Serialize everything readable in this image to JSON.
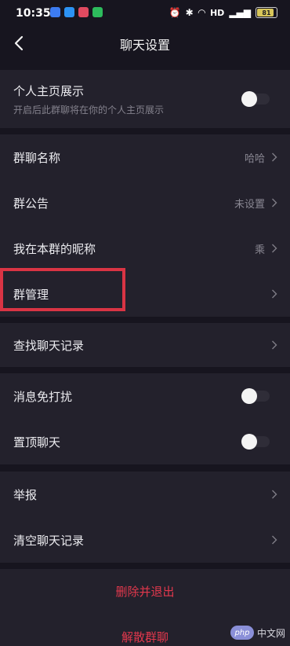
{
  "status": {
    "time": "10:35",
    "battery": "81",
    "net": "HD"
  },
  "nav": {
    "title": "聊天设置"
  },
  "profile_section": {
    "label": "个人主页展示",
    "subtitle": "开启后此群聊将在你的个人主页展示",
    "toggle_on": false
  },
  "group_section": {
    "items": [
      {
        "label": "群聊名称",
        "value": "哈哈"
      },
      {
        "label": "群公告",
        "value": "未设置"
      },
      {
        "label": "我在本群的昵称",
        "value": "乘"
      },
      {
        "label": "群管理",
        "value": ""
      }
    ]
  },
  "search_section": {
    "label": "查找聊天记录"
  },
  "notify_section": {
    "items": [
      {
        "label": "消息免打扰",
        "toggle_on": false
      },
      {
        "label": "置顶聊天",
        "toggle_on": false
      }
    ]
  },
  "report_section": {
    "items": [
      {
        "label": "举报"
      },
      {
        "label": "清空聊天记录"
      }
    ]
  },
  "danger_actions": {
    "delete_exit": "删除并退出",
    "dissolve": "解散群聊"
  },
  "colors": {
    "background": "#17151f",
    "cell": "#23212c",
    "danger": "#e2384d",
    "highlight": "#d93444"
  },
  "watermark": {
    "logo": "php",
    "text": "中文网"
  }
}
